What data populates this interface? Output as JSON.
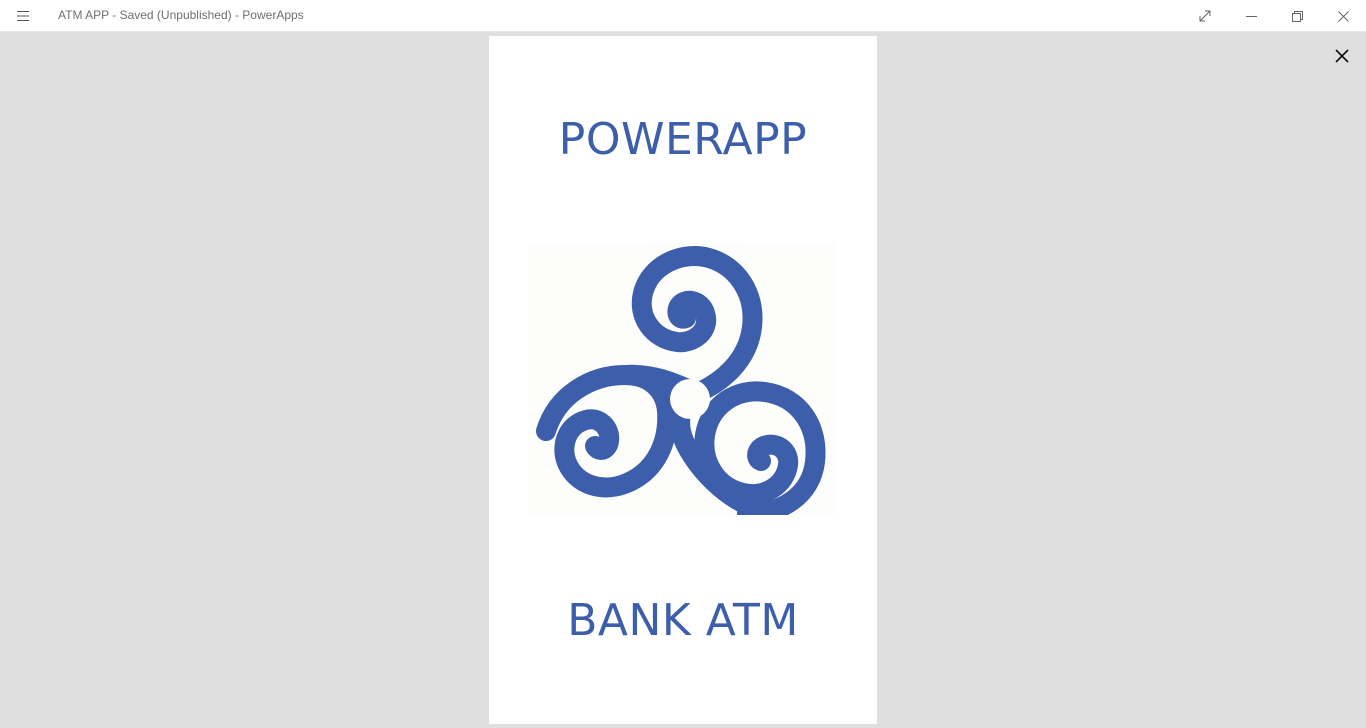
{
  "window": {
    "title": "ATM APP - Saved (Unpublished) - PowerApps",
    "menu_icon": "hamburger-menu-icon",
    "controls": {
      "expand_icon": "expand-icon",
      "minimize_icon": "minimize-icon",
      "restore_icon": "restore-icon",
      "close_icon": "close-icon"
    }
  },
  "preview": {
    "close_icon": "close-icon"
  },
  "screen": {
    "heading": "POWERAPP",
    "logo_icon": "triskelion-logo-icon",
    "subheading": "BANK ATM"
  },
  "colors": {
    "brand": "#3c5eab",
    "workspace_background": "#dfdfdf",
    "canvas_background": "#ffffff"
  }
}
